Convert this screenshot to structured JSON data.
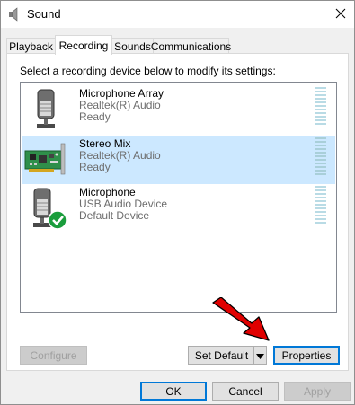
{
  "window": {
    "title": "Sound"
  },
  "tabs": [
    {
      "label": "Playback",
      "active": false
    },
    {
      "label": "Recording",
      "active": true
    },
    {
      "label": "Sounds",
      "active": false
    },
    {
      "label": "Communications",
      "active": false
    }
  ],
  "instruction": "Select a recording device below to modify its settings:",
  "devices": [
    {
      "name": "Microphone Array",
      "driver": "Realtek(R) Audio",
      "status": "Ready",
      "icon": "microphone-icon",
      "selected": false
    },
    {
      "name": "Stereo Mix",
      "driver": "Realtek(R) Audio",
      "status": "Ready",
      "icon": "sound-card-icon",
      "selected": true
    },
    {
      "name": "Microphone",
      "driver": "USB Audio Device",
      "status": "Default Device",
      "icon": "microphone-default-icon",
      "selected": false
    }
  ],
  "buttons": {
    "configure": "Configure",
    "set_default": "Set Default",
    "properties": "Properties",
    "ok": "OK",
    "cancel": "Cancel",
    "apply": "Apply"
  },
  "colors": {
    "selection": "#cce8ff",
    "accent": "#0078d7",
    "annotation_arrow": "#e00000",
    "default_check": "#1a9d3c"
  }
}
